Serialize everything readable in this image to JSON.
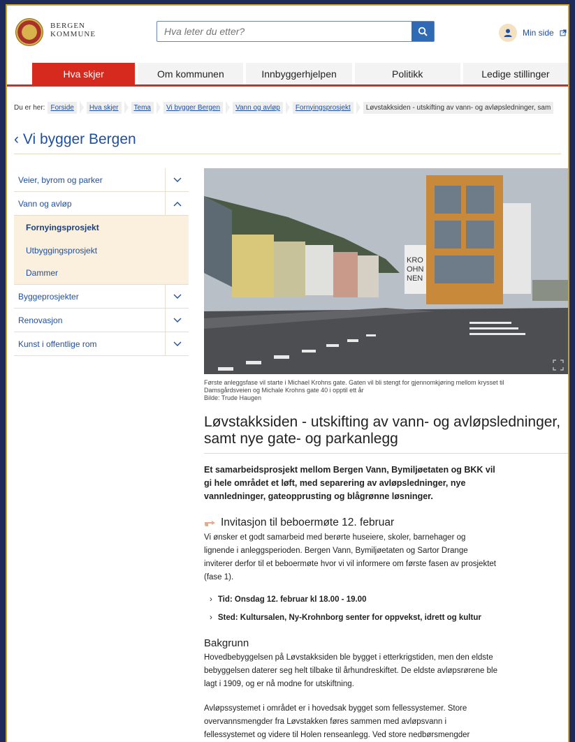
{
  "header": {
    "logo_line1": "BERGEN",
    "logo_line2": "KOMMUNE",
    "search_placeholder": "Hva leter du etter?",
    "minside_label": "Min side"
  },
  "nav": {
    "tabs": [
      {
        "label": "Hva skjer",
        "active": true
      },
      {
        "label": "Om kommunen",
        "active": false
      },
      {
        "label": "Innbyggerhjelpen",
        "active": false
      },
      {
        "label": "Politikk",
        "active": false
      },
      {
        "label": "Ledige stillinger",
        "active": false
      }
    ]
  },
  "breadcrumb": {
    "label": "Du er her:",
    "items": [
      "Forside",
      "Hva skjer",
      "Tema",
      "Vi bygger Bergen",
      "Vann og avløp",
      "Fornyingsprosjekt"
    ],
    "current": "Løvstakksiden - utskifting av vann- og avløpsledninger, sam"
  },
  "back_link": "‹ Vi bygger Bergen",
  "sidebar": {
    "items": [
      {
        "label": "Veier, byrom og parker",
        "expanded": false
      },
      {
        "label": "Vann og avløp",
        "expanded": true
      },
      {
        "label": "Byggeprosjekter",
        "expanded": false
      },
      {
        "label": "Renovasjon",
        "expanded": false
      },
      {
        "label": "Kunst i offentlige rom",
        "expanded": false
      }
    ],
    "subitems": [
      {
        "label": "Fornyingsprosjekt",
        "current": true
      },
      {
        "label": "Utbyggingsprosjekt",
        "current": false
      },
      {
        "label": "Dammer",
        "current": false
      }
    ]
  },
  "article": {
    "photo_sign": "KRO\nOHN\nNEN",
    "caption_line1": "Første anleggsfase vil starte i Michael Krohns gate. Gaten vil bli stengt for gjennomkjøring mellom krysset til",
    "caption_line2": "Damsgårdsveien og Michale Krohns gate 40 i opptil ett år",
    "caption_credit": "Bilde: Trude Haugen",
    "title": "Løvstakksiden - utskifting av vann- og avløpsledninger, samt nye gate- og parkanlegg",
    "lead": "Et samarbeidsprosjekt mellom Bergen Vann, Bymiljøetaten og BKK vil gi hele området et løft, med separering av avløpsledninger, nye vannledninger, gateopprusting og blågrønne løsninger.",
    "invitation_title": "Invitasjon til beboermøte 12. februar",
    "invitation_text": "Vi ønsker et godt samarbeid med berørte huseiere, skoler, barnehager og lignende i anleggsperioden. Bergen Vann, Bymiljøetaten og Sartor Drange inviterer derfor til et beboermøte hvor vi vil informere om første fasen av prosjektet (fase 1).",
    "bullet_time": "Tid: Onsdag 12. februar kl 18.00 - 19.00",
    "bullet_place": "Sted: Kultursalen, Ny-Krohnborg senter for oppvekst, idrett og kultur",
    "background_title": "Bakgrunn",
    "background_p1": "Hovedbebyggelsen på Løvstakksiden ble bygget i etterkrigstiden, men den eldste bebyggelsen daterer seg helt tilbake til århundreskiftet. De eldste avløpsrørene ble lagt i 1909, og er nå modne for utskiftning.",
    "background_p2": "Avløpssystemet i området er i hovedsak bygget som fellessystemer. Store overvannsmengder fra Løvstakken føres sammen med avløpsvann i fellessystemet og videre til Holen renseanlegg. Ved store nedbørsmengder"
  },
  "colors": {
    "brand_red": "#d62a1e",
    "link_blue": "#1f4fa0",
    "outer_navy": "#1e2a5a",
    "frame_gold": "#c9a227"
  }
}
